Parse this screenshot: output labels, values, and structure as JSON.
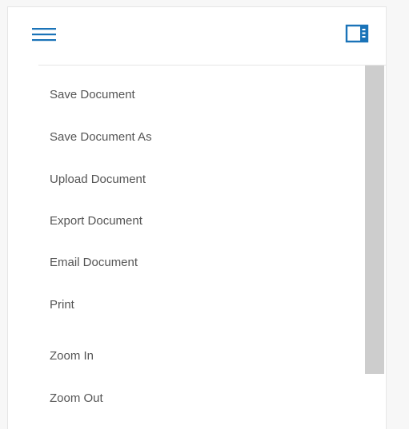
{
  "header": {
    "menu_icon": "hamburger-menu-icon",
    "panel_icon": "side-panel-icon",
    "accent_color": "#1a73b8"
  },
  "menu": {
    "items": [
      {
        "label": "Save Document"
      },
      {
        "label": "Save Document As"
      },
      {
        "label": "Upload Document"
      },
      {
        "label": "Export Document"
      },
      {
        "label": "Email Document"
      },
      {
        "label": "Print"
      },
      {
        "label": "Zoom In"
      },
      {
        "label": "Zoom Out"
      }
    ]
  },
  "scrollbar": {
    "thumb_color": "#cdcdcd"
  }
}
